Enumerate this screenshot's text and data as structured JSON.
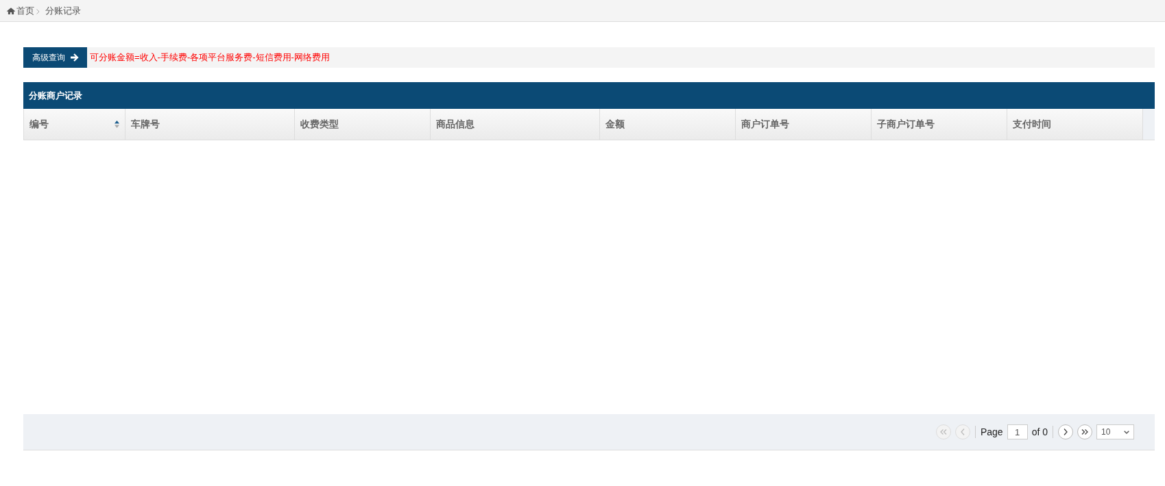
{
  "breadcrumb": [
    {
      "label": "首页",
      "kind": "home"
    },
    {
      "label": "分账记录",
      "kind": "current"
    }
  ],
  "query_bar": {
    "button": "高级查询",
    "formula": "可分账金额=收入-手续费-各项平台服务费-短信费用-网络费用"
  },
  "table": {
    "title": "分账商户记录",
    "columns": [
      {
        "label": "编号",
        "sorted": true
      },
      {
        "label": "车牌号",
        "sorted": false
      },
      {
        "label": "收费类型",
        "sorted": false
      },
      {
        "label": "商品信息",
        "sorted": false
      },
      {
        "label": "金额",
        "sorted": false
      },
      {
        "label": "商户订单号",
        "sorted": false
      },
      {
        "label": "子商户订单号",
        "sorted": false
      },
      {
        "label": "支付时间",
        "sorted": false
      }
    ]
  },
  "pager": {
    "buttons": [
      {
        "kind": "first",
        "disabled": true
      },
      {
        "kind": "prev",
        "disabled": true
      },
      {
        "kind": "next",
        "disabled": false
      },
      {
        "kind": "last",
        "disabled": false
      }
    ],
    "page_label": "Page",
    "page": "1",
    "of_text": "of 0",
    "page_size": "10"
  }
}
